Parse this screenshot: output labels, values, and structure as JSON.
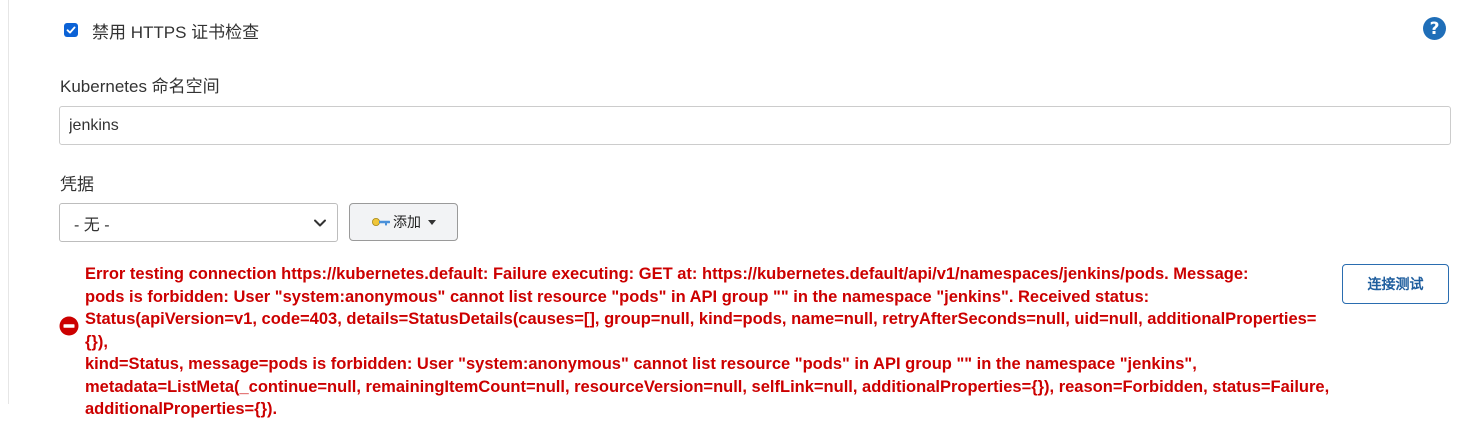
{
  "colors": {
    "checkbox": "#0b62d6",
    "help": "#1f6eb8",
    "error": "#cc0000",
    "accent_button_border": "#2a6db0"
  },
  "icons": {
    "checkbox": "checkmark-icon",
    "help": "question-circle-icon",
    "add": "key-icon",
    "dropdown": "chevron-down-icon",
    "error": "error-circle-icon"
  },
  "disable_https_check": {
    "checked": true,
    "label": "禁用 HTTPS 证书检查"
  },
  "help": {
    "symbol": "?"
  },
  "namespace": {
    "label": "Kubernetes 命名空间",
    "value": "jenkins"
  },
  "credentials": {
    "label": "凭据",
    "selected": "- 无 -",
    "add_label": "添加"
  },
  "error": {
    "message": "Error testing connection https://kubernetes.default: Failure executing: GET at: https://kubernetes.default/api/v1/namespaces/jenkins/pods. Message:\npods is forbidden: User \"system:anonymous\" cannot list resource \"pods\" in API group \"\" in the namespace \"jenkins\". Received status:\nStatus(apiVersion=v1, code=403, details=StatusDetails(causes=[], group=null, kind=pods, name=null, retryAfterSeconds=null, uid=null, additionalProperties={}),\nkind=Status, message=pods is forbidden: User \"system:anonymous\" cannot list resource \"pods\" in API group \"\" in the namespace \"jenkins\",\nmetadata=ListMeta(_continue=null, remainingItemCount=null, resourceVersion=null, selfLink=null, additionalProperties={}), reason=Forbidden, status=Failure,\nadditionalProperties={})."
  },
  "test_connection": {
    "label": "连接测试"
  }
}
